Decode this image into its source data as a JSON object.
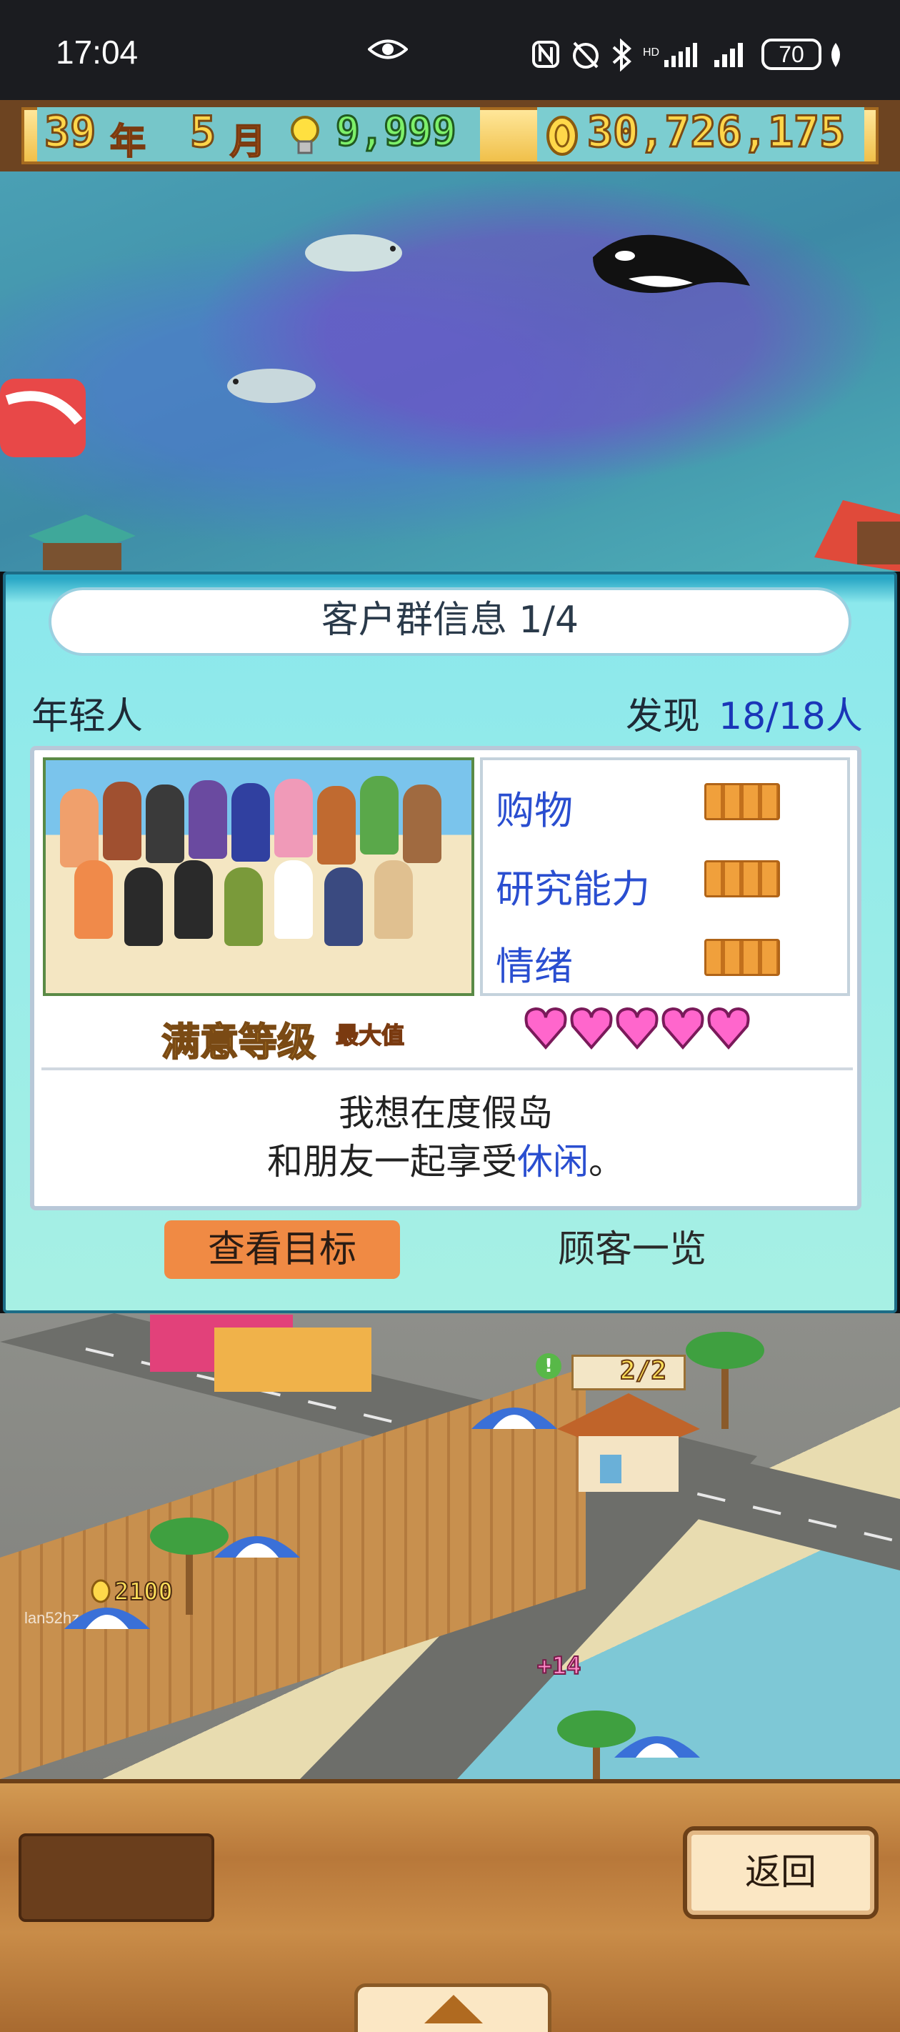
{
  "status_bar": {
    "time": "17:04",
    "battery": "70",
    "icons": [
      "eye-icon",
      "nfc-icon",
      "alarm-off-icon",
      "bluetooth-icon",
      "signal-icon",
      "signal-icon",
      "battery-icon",
      "leaf-icon"
    ]
  },
  "hud": {
    "year": "39",
    "year_label": "年",
    "month": "5",
    "month_label": "月",
    "ideas": "9,999",
    "money": "30,726,175"
  },
  "dialog": {
    "title": "客户群信息 1/4",
    "group_name": "年轻人",
    "found_label": "发现",
    "found_count": "18/18人",
    "stats": [
      {
        "label": "购物",
        "level_fraction": 1.0
      },
      {
        "label": "研究能力",
        "level_fraction": 1.0
      },
      {
        "label": "情绪",
        "level_fraction": 1.0
      }
    ],
    "satisfaction_label": "满意等级",
    "satisfaction_badge": "最大值",
    "hearts": 5,
    "quote_line1": "我想在度假岛",
    "quote_line2_pre": "和朋友一起享受",
    "quote_line2_highlight": "休闲",
    "quote_line2_post": "。",
    "view_goal_button": "查看目标",
    "customer_list_button": "顾客一览"
  },
  "scene": {
    "notice_count": "2/2",
    "coin_float": "2100",
    "plus_float": "+14",
    "watermark": "lan52hz"
  },
  "bottom": {
    "back_button": "返回"
  },
  "colors": {
    "dialog_bg": "#a7f0e4",
    "accent_blue": "#2a4ed0",
    "goal_button": "#f08a44",
    "hearts": "#ff66cc"
  }
}
